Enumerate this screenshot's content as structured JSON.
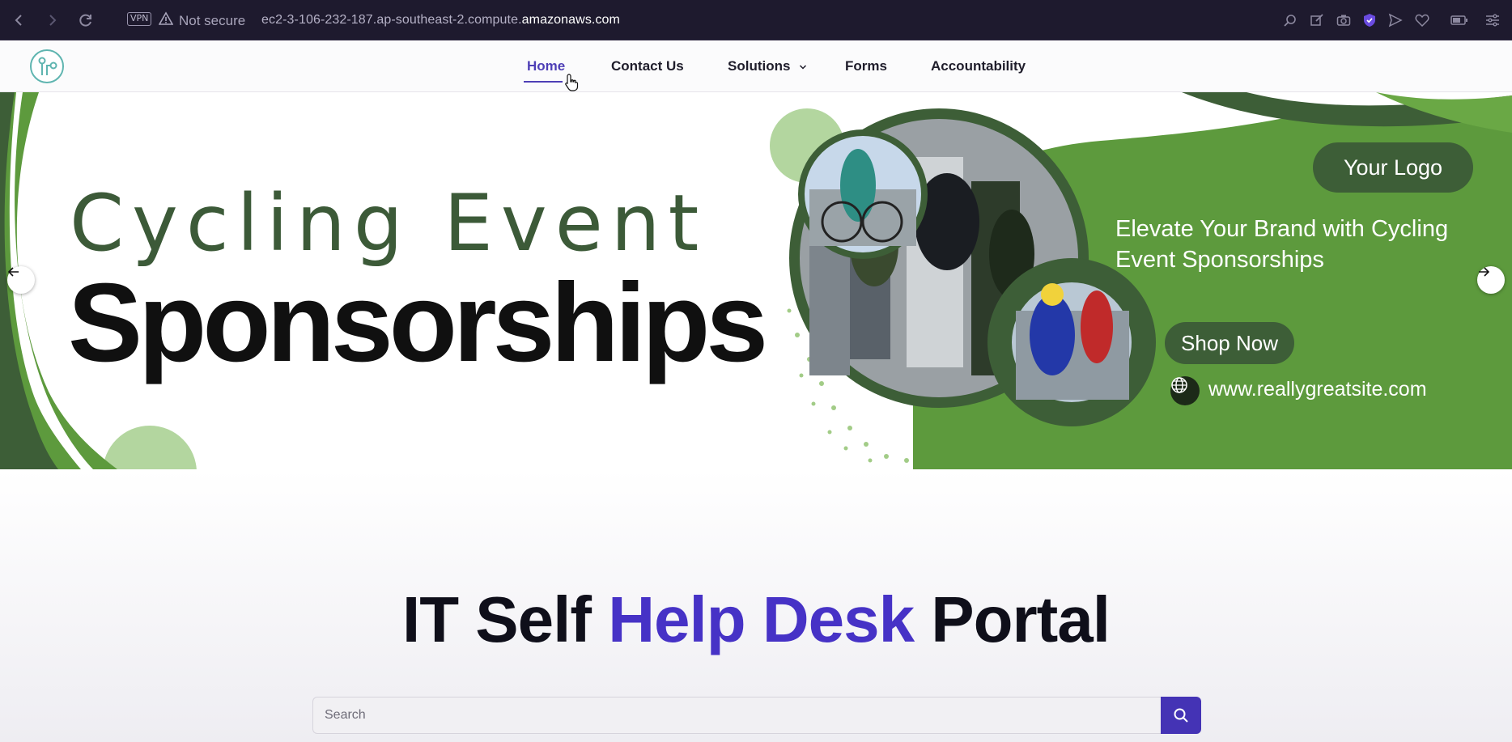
{
  "browser": {
    "vpn_label": "VPN",
    "security_label": "Not secure",
    "url_prefix": "ec2-3-106-232-187.ap-southeast-2.compute.",
    "url_domain": "amazonaws.com"
  },
  "nav": {
    "items": [
      {
        "label": "Home",
        "active": true
      },
      {
        "label": "Contact Us"
      },
      {
        "label": "Solutions",
        "has_dropdown": true
      },
      {
        "label": "Forms"
      },
      {
        "label": "Accountability"
      }
    ]
  },
  "hero": {
    "title_line1": "Cycling Event",
    "title_line2": "Sponsorships",
    "logo_pill": "Your Logo",
    "tagline": "Elevate Your Brand with Cycling Event Sponsorships",
    "cta": "Shop Now",
    "website": "www.reallygreatsite.com",
    "colors": {
      "dark_green": "#3d5e37",
      "green": "#5d9a3d",
      "light_green": "#b3d69f"
    }
  },
  "portal": {
    "title_part1": "IT Self ",
    "title_accent": "Help Desk",
    "title_part2": " Portal",
    "accent_color": "#4632c6",
    "search_placeholder": "Search"
  }
}
